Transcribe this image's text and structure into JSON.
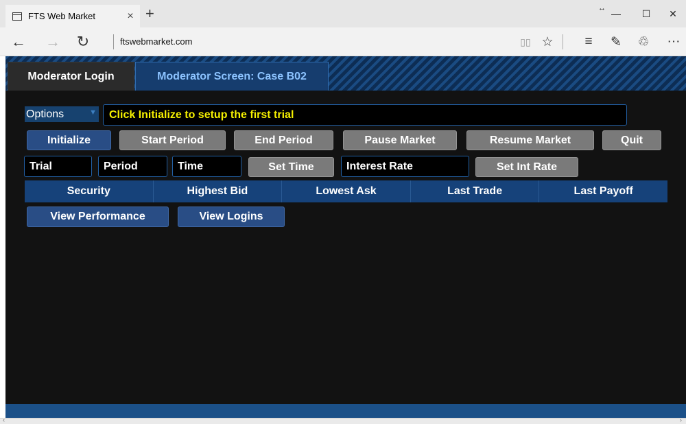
{
  "browser": {
    "tab_title": "FTS Web Market",
    "tab_close": "×",
    "new_tab": "+",
    "url": "ftswebmarket.com",
    "controls": {
      "resize": "↔",
      "minimize": "—",
      "maximize": "☐",
      "close": "✕"
    },
    "nav": {
      "back": "←",
      "forward": "→",
      "refresh": "↻"
    },
    "toolbar": {
      "reading_view": "▯▯",
      "favorite": "☆",
      "hub": "≡",
      "web_note": "✎",
      "share": "♲",
      "more": "···"
    }
  },
  "app": {
    "tabs": [
      {
        "label": "Moderator Login"
      },
      {
        "label": "Moderator Screen: Case B02",
        "active": true
      }
    ],
    "options_label": "Options",
    "status_message": "Click Initialize to setup the first trial",
    "buttons_row1": {
      "initialize": "Initialize",
      "start_period": "Start Period",
      "end_period": "End Period",
      "pause_market": "Pause Market",
      "resume_market": "Resume Market",
      "quit": "Quit"
    },
    "fields": {
      "trial": "Trial",
      "period": "Period",
      "time": "Time",
      "interest_rate": "Interest Rate"
    },
    "buttons_row2": {
      "set_time": "Set Time",
      "set_int_rate": "Set Int Rate"
    },
    "table_headers": [
      "Security",
      "Highest Bid",
      "Lowest Ask",
      "Last Trade",
      "Last Payoff"
    ],
    "buttons_row3": {
      "view_performance": "View Performance",
      "view_logins": "View Logins"
    },
    "colors": {
      "background": "#121212",
      "status_text": "#f5f000",
      "blue_button": "#294d85",
      "grey_button": "#7a7a7a",
      "header_bar": "#16427a"
    }
  }
}
